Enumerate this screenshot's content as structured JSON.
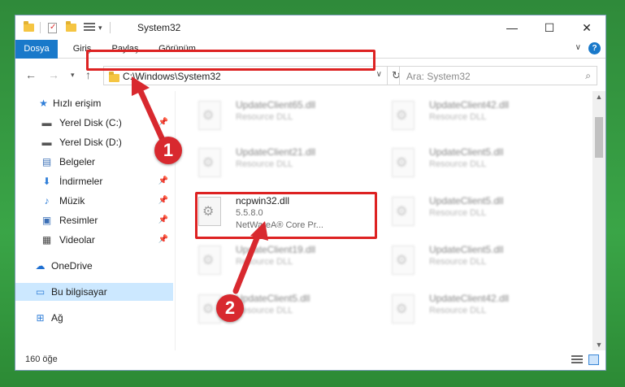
{
  "window": {
    "title": "System32",
    "controls": {
      "minimize": "—",
      "maximize": "☐",
      "close": "✕"
    }
  },
  "ribbon": {
    "tabs": [
      "Dosya",
      "Giriş",
      "Paylaş",
      "Görünüm"
    ],
    "help_label": "?"
  },
  "address": {
    "path": "C:\\Windows\\System32",
    "search_placeholder": "Ara: System32"
  },
  "sidebar": {
    "items": [
      {
        "label": "Hızlı erişim",
        "icon": "star-icon",
        "glyph": "★",
        "color": "#2f7ed8"
      },
      {
        "label": "Yerel Disk (C:)",
        "icon": "drive-icon",
        "glyph": "▬",
        "color": "#555555"
      },
      {
        "label": "Yerel Disk (D:)",
        "icon": "drive-icon",
        "glyph": "▬",
        "color": "#555555"
      },
      {
        "label": "Belgeler",
        "icon": "document-icon",
        "glyph": "▤",
        "color": "#3b6fb6"
      },
      {
        "label": "İndirmeler",
        "icon": "download-icon",
        "glyph": "⬇",
        "color": "#2f7ed8"
      },
      {
        "label": "Müzik",
        "icon": "music-icon",
        "glyph": "♪",
        "color": "#2f7ed8"
      },
      {
        "label": "Resimler",
        "icon": "pictures-icon",
        "glyph": "▣",
        "color": "#3b6fb6"
      },
      {
        "label": "Videolar",
        "icon": "video-icon",
        "glyph": "▦",
        "color": "#444444"
      },
      {
        "label": "OneDrive",
        "icon": "cloud-icon",
        "glyph": "☁",
        "color": "#1f6fd1"
      },
      {
        "label": "Bu bilgisayar",
        "icon": "computer-icon",
        "glyph": "▭",
        "color": "#2f7ed8"
      },
      {
        "label": "Ağ",
        "icon": "network-icon",
        "glyph": "⊞",
        "color": "#2f7ed8"
      }
    ]
  },
  "files": {
    "subtitle": "Resource DLL",
    "left": [
      "UpdateClient65.dll",
      "UpdateClient21.dll",
      "UpdateClient19.dll",
      "UpdateClient5.dll"
    ],
    "right": [
      "UpdateClient42.dll",
      "UpdateClient5.dll",
      "UpdateClient5.dll",
      "UpdateClient5.dll",
      "UpdateClient42.dll"
    ],
    "highlighted": {
      "name": "ncpwin32.dll",
      "version": "5.5.8.0",
      "company": "NetWareA® Core Pr..."
    }
  },
  "status": {
    "count": "160 öğe"
  },
  "callouts": {
    "one": "1",
    "two": "2"
  },
  "colors": {
    "accent": "#1979ca",
    "highlight": "#dd2222",
    "selected": "#cce8ff"
  }
}
